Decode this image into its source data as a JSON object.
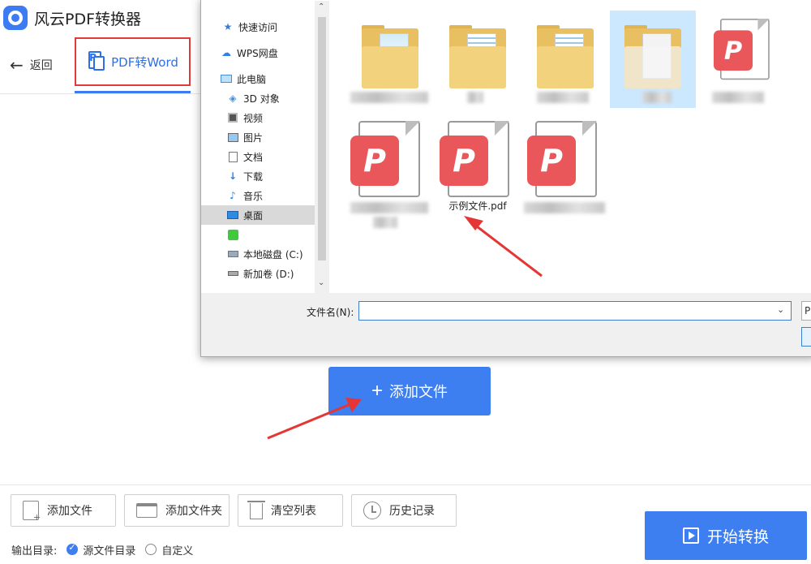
{
  "app": {
    "title": "风云PDF转换器"
  },
  "nav": {
    "back_label": "返回",
    "active_tab_label": "PDF转Word"
  },
  "dialog": {
    "sidebar": [
      {
        "label": "快速访问",
        "icon": "star-icon"
      },
      {
        "label": "WPS网盘",
        "icon": "cloud-icon"
      },
      {
        "label": "此电脑",
        "icon": "computer-icon"
      },
      {
        "label": "3D 对象",
        "icon": "cube-icon"
      },
      {
        "label": "视频",
        "icon": "video-icon"
      },
      {
        "label": "图片",
        "icon": "picture-icon"
      },
      {
        "label": "文档",
        "icon": "document-icon"
      },
      {
        "label": "下载",
        "icon": "download-icon"
      },
      {
        "label": "音乐",
        "icon": "music-icon"
      },
      {
        "label": "桌面",
        "icon": "desktop-icon",
        "selected": true
      },
      {
        "label": "",
        "icon": "app-icon"
      },
      {
        "label": "本地磁盘 (C:)",
        "icon": "drive-icon"
      },
      {
        "label": "新加卷 (D:)",
        "icon": "drive-icon"
      }
    ],
    "files": [
      {
        "type": "folder",
        "name": ""
      },
      {
        "type": "folder",
        "name": ""
      },
      {
        "type": "folder",
        "name": ""
      },
      {
        "type": "folder",
        "name": "",
        "selected": true
      },
      {
        "type": "pdf",
        "name": ""
      },
      {
        "type": "pdf",
        "name": ""
      },
      {
        "type": "pdf",
        "name": "示例文件.pdf"
      },
      {
        "type": "pdf",
        "name": ""
      }
    ],
    "filename_label": "文件名(N):",
    "filename_value": "",
    "filetype_button": "PI"
  },
  "main": {
    "add_file_button": "添加文件"
  },
  "toolbar": {
    "add_file": "添加文件",
    "add_folder": "添加文件夹",
    "clear_list": "清空列表",
    "history": "历史记录"
  },
  "output": {
    "label": "输出目录:",
    "option_source": "源文件目录",
    "option_custom": "自定义",
    "selected": "source"
  },
  "start_button": "开始转换",
  "colors": {
    "accent": "#3d7ff0",
    "highlight_box": "#e03a3a",
    "pdf_badge": "#e9575a"
  }
}
